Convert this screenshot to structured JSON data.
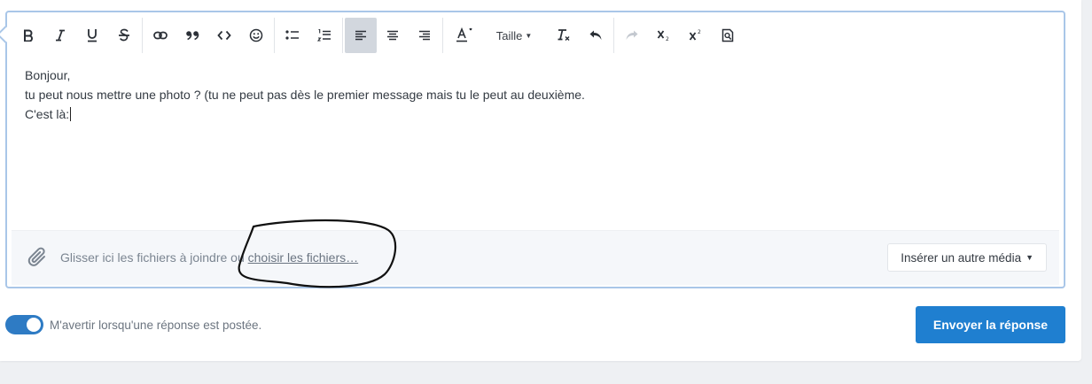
{
  "toolbar": {
    "buttons": [
      {
        "name": "bold-button",
        "icon": "bold-icon"
      },
      {
        "name": "italic-button",
        "icon": "italic-icon"
      },
      {
        "name": "underline-button",
        "icon": "underline-icon"
      },
      {
        "name": "strikethrough-button",
        "icon": "strikethrough-icon"
      },
      {
        "name": "link-button",
        "icon": "link-icon"
      },
      {
        "name": "quote-button",
        "icon": "quote-icon"
      },
      {
        "name": "code-button",
        "icon": "code-icon"
      },
      {
        "name": "emoji-button",
        "icon": "emoji-icon"
      },
      {
        "name": "bullet-list-button",
        "icon": "bullet-list-icon"
      },
      {
        "name": "numbered-list-button",
        "icon": "numbered-list-icon"
      },
      {
        "name": "align-left-button",
        "icon": "align-left-icon",
        "active": true
      },
      {
        "name": "align-center-button",
        "icon": "align-center-icon"
      },
      {
        "name": "align-right-button",
        "icon": "align-right-icon"
      },
      {
        "name": "text-color-button",
        "icon": "text-color-icon"
      },
      {
        "name": "clear-format-button",
        "icon": "clear-format-icon"
      },
      {
        "name": "undo-button",
        "icon": "undo-icon"
      },
      {
        "name": "redo-button",
        "icon": "redo-icon",
        "disabled": true
      },
      {
        "name": "subscript-button",
        "icon": "subscript-icon"
      },
      {
        "name": "superscript-button",
        "icon": "superscript-icon"
      },
      {
        "name": "preview-button",
        "icon": "preview-icon"
      }
    ],
    "size_label": "Taille"
  },
  "content": {
    "lines": [
      "Bonjour,",
      "tu peut nous mettre une photo ? (tu ne peut pas dès le premier message mais tu le peut au deuxième.",
      "C'est là:"
    ]
  },
  "attachments": {
    "drop_text": "Glisser ici les fichiers à joindre ou ",
    "choose_link": "choisir les fichiers…",
    "media_button": "Insérer un autre média"
  },
  "footer": {
    "watch_label": "M'avertir lorsqu'une réponse est postée.",
    "watch_enabled": true,
    "submit_label": "Envoyer la réponse"
  },
  "colors": {
    "accent": "#1f7fd0",
    "editor_border": "#a9c6e8",
    "toggle_on": "#2e7bc4"
  }
}
